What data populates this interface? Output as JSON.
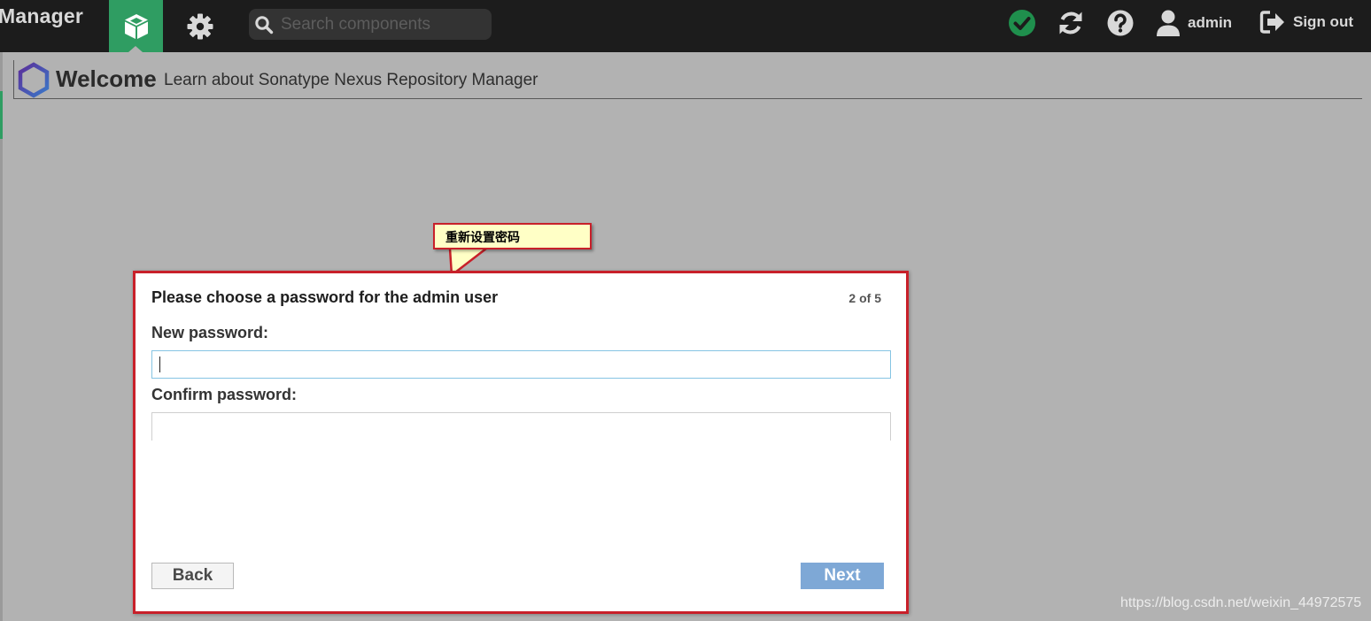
{
  "app": {
    "brand": "Manager"
  },
  "topbar": {
    "search_placeholder": "Search components",
    "user_label": "admin",
    "signout_label": "Sign out",
    "colors": {
      "bar": "#1c1c1c",
      "active": "#2f9d62",
      "status_ok": "#1f8f4d"
    }
  },
  "welcome": {
    "title": "Welcome",
    "subtitle": "Learn about Sonatype Nexus Repository Manager"
  },
  "callout": {
    "text": "重新设置密码"
  },
  "dialog": {
    "title": "Please choose a password for the admin user",
    "step": "2 of 5",
    "new_password_label": "New password:",
    "new_password_value": "",
    "confirm_password_label": "Confirm password:",
    "confirm_password_value": "",
    "back_label": "Back",
    "next_label": "Next"
  },
  "watermark": "https://blog.csdn.net/weixin_44972575"
}
